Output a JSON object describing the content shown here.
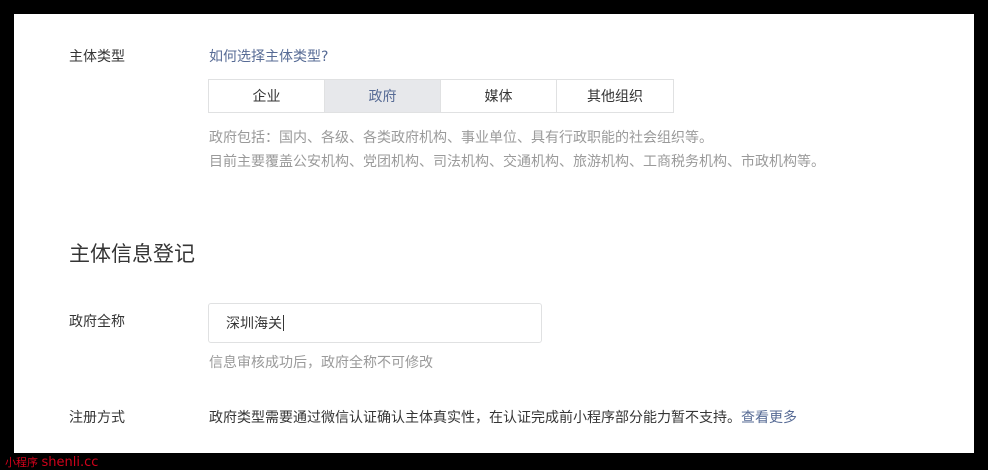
{
  "subject_type": {
    "label": "主体类型",
    "help_link": "如何选择主体类型?",
    "options": [
      "企业",
      "政府",
      "媒体",
      "其他组织"
    ],
    "selected_index": 1,
    "description_line1": "政府包括：国内、各级、各类政府机构、事业单位、具有行政职能的社会组织等。",
    "description_line2": "目前主要覆盖公安机构、党团机构、司法机构、交通机构、旅游机构、工商税务机构、市政机构等。"
  },
  "section": {
    "title": "主体信息登记"
  },
  "gov_name": {
    "label": "政府全称",
    "value": "深圳海关",
    "hint": "信息审核成功后，政府全称不可修改"
  },
  "registration": {
    "label": "注册方式",
    "text": "政府类型需要通过微信认证确认主体真实性，在认证完成前小程序部分能力暂不支持。",
    "link": "查看更多"
  },
  "watermark": {
    "small": "小程序",
    "big": "shenli.cc"
  },
  "colors": {
    "link": "#576b95",
    "text": "#353535",
    "muted": "#9a9a9a",
    "active_bg": "#e7e8eb"
  }
}
